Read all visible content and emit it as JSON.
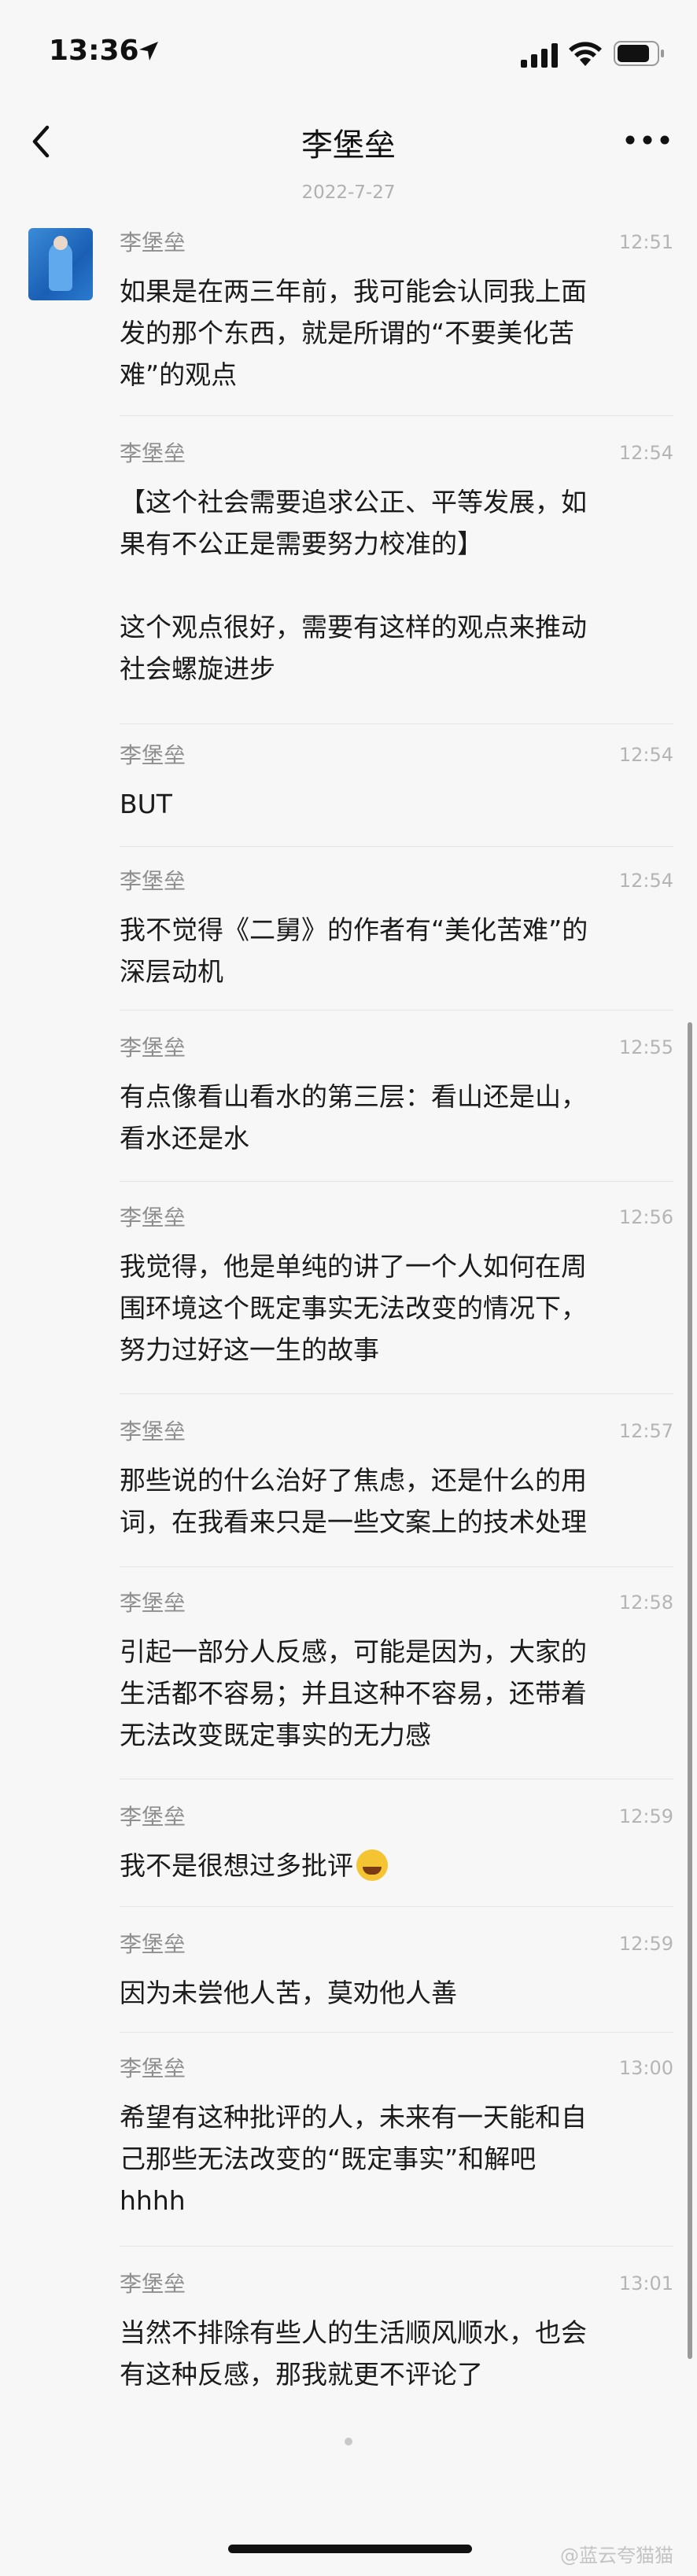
{
  "status": {
    "time": "13:36"
  },
  "nav": {
    "title": "李堡垒"
  },
  "date": "2022-7-27",
  "messages": [
    {
      "sender": "李堡垒",
      "time": "12:51",
      "text": "如果是在两三年前，我可能会认同我上面\n发的那个东西，就是所谓的“不要美化苦\n难”的观点"
    },
    {
      "sender": "李堡垒",
      "time": "12:54",
      "text": "【这个社会需要追求公正、平等发展，如\n果有不公正是需要努力校准的】\n\n这个观点很好，需要有这样的观点来推动\n社会螺旋进步"
    },
    {
      "sender": "李堡垒",
      "time": "12:54",
      "text": "BUT"
    },
    {
      "sender": "李堡垒",
      "time": "12:54",
      "text": "我不觉得《二舅》的作者有“美化苦难”的\n深层动机"
    },
    {
      "sender": "李堡垒",
      "time": "12:55",
      "text": "有点像看山看水的第三层：看山还是山，\n看水还是水"
    },
    {
      "sender": "李堡垒",
      "time": "12:56",
      "text": "我觉得，他是单纯的讲了一个人如何在周\n围环境这个既定事实无法改变的情况下，\n努力过好这一生的故事"
    },
    {
      "sender": "李堡垒",
      "time": "12:57",
      "text": "那些说的什么治好了焦虑，还是什么的用\n词，在我看来只是一些文案上的技术处理"
    },
    {
      "sender": "李堡垒",
      "time": "12:58",
      "text": "引起一部分人反感，可能是因为，大家的\n生活都不容易；并且这种不容易，还带着\n无法改变既定事实的无力感"
    },
    {
      "sender": "李堡垒",
      "time": "12:59",
      "text": "我不是很想过多批评",
      "emoji": "laughing-tears-emoji"
    },
    {
      "sender": "李堡垒",
      "time": "12:59",
      "text": "因为未尝他人苦，莫劝他人善"
    },
    {
      "sender": "李堡垒",
      "time": "13:00",
      "text": "希望有这种批评的人，未来有一天能和自\n己那些无法改变的“既定事实”和解吧\nhhhh"
    },
    {
      "sender": "李堡垒",
      "time": "13:01",
      "text": "当然不排除有些人的生活顺风顺水，也会\n有这种反感，那我就更不评论了"
    }
  ],
  "watermark": "@蓝云夸猫猫"
}
